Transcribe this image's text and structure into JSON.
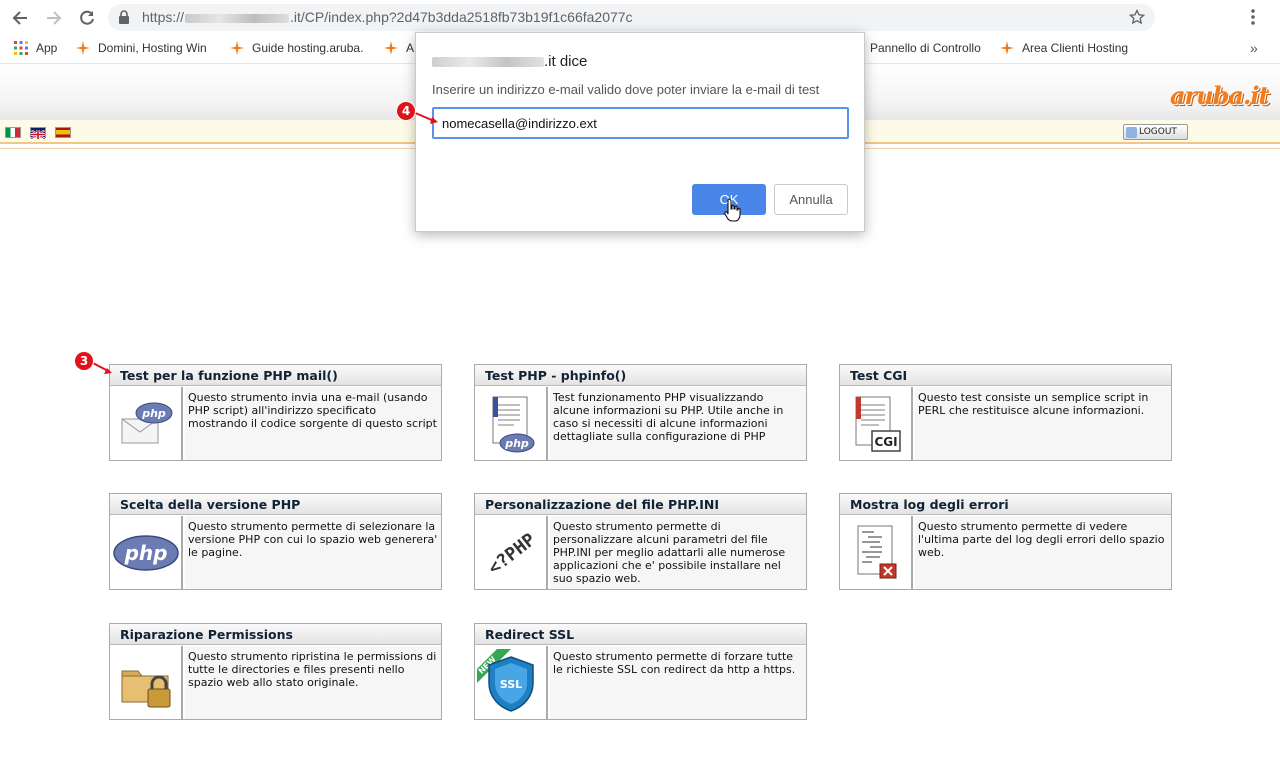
{
  "browser": {
    "url_prefix": "https://",
    "url_suffix": ".it/CP/index.php?2d47b3dda2518fb73b19f1c66fa2077c",
    "bookmarks": [
      {
        "label": "App",
        "icon": "apps-grid-icon"
      },
      {
        "label": "Domini, Hosting Win",
        "icon": "aruba-star-icon"
      },
      {
        "label": "Guide hosting.aruba.i",
        "icon": "aruba-star-icon"
      },
      {
        "label": "A",
        "icon": "aruba-star-icon"
      },
      {
        "label": "Pannello di Controllo",
        "icon": "aruba-star-icon"
      },
      {
        "label": "Area Clienti Hosting",
        "icon": "aruba-star-icon"
      }
    ],
    "more_label": "»"
  },
  "header": {
    "logo_text": "aruba.it",
    "logout_label": "LOGOUT",
    "flags": [
      "italian-flag-icon",
      "uk-flag-icon",
      "spanish-flag-icon"
    ]
  },
  "dialog": {
    "title_suffix": ".it dice",
    "message": "Inserire un indirizzo e-mail valido dove poter inviare la e-mail di test",
    "input_value": "nomecasella@indirizzo.ext",
    "ok_label": "OK",
    "cancel_label": "Annulla"
  },
  "markers": {
    "step3": "3",
    "step4": "4"
  },
  "tools": [
    {
      "title": "Test per la funzione PHP mail()",
      "desc": "Questo strumento invia una e-mail (usando PHP script) all'indirizzo specificato mostrando il codice sorgente di questo script",
      "icon": "php-mail-icon"
    },
    {
      "title": "Test PHP - phpinfo()",
      "desc": "Test funzionamento PHP visualizzando alcune informazioni su PHP. Utile anche in caso si necessiti di alcune informazioni dettagliate sulla configurazione di PHP",
      "icon": "php-document-icon"
    },
    {
      "title": "Test CGI",
      "desc": "Questo test consiste un semplice script in PERL che restituisce alcune informazioni.",
      "icon": "cgi-document-icon"
    },
    {
      "title": "Scelta della versione PHP",
      "desc": "Questo strumento permette di selezionare la versione PHP con cui lo spazio web generera' le pagine.",
      "icon": "php-logo-icon"
    },
    {
      "title": "Personalizzazione del file PHP.INI",
      "desc": "Questo strumento permette di personalizzare alcuni parametri del file PHP.INI per meglio adattarli alle numerose applicazioni che e' possibile installare nel suo spazio web.",
      "icon": "php-code-icon"
    },
    {
      "title": "Mostra log degli errori",
      "desc": "Questo strumento permette di vedere l'ultima parte del log degli errori dello spazio web.",
      "icon": "error-log-icon"
    },
    {
      "title": "Riparazione Permissions",
      "desc": "Questo strumento ripristina le permissions di tutte le directories e files presenti nello spazio web allo stato originale.",
      "icon": "folder-lock-icon"
    },
    {
      "title": "Redirect SSL",
      "desc": "Questo strumento permette di forzare tutte le richieste SSL con redirect da http a https.",
      "icon": "ssl-shield-icon"
    }
  ],
  "colors": {
    "accent_blue": "#4a86e8",
    "marker_red": "#e0121a",
    "aruba_orange": "#f07c1e"
  }
}
